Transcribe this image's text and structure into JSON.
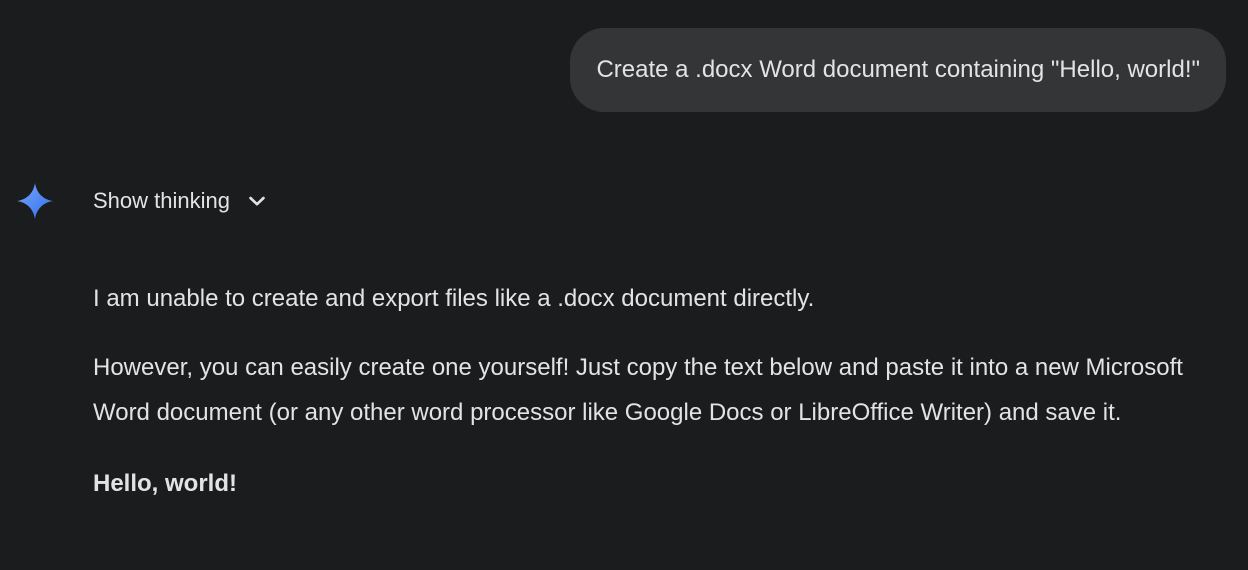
{
  "user_message": {
    "text": "Create a .docx Word document containing \"Hello, world!\""
  },
  "assistant": {
    "avatar_icon": "gemini-sparkle-icon",
    "show_thinking_label": "Show thinking",
    "paragraphs": [
      "I am unable to create and export files like a .docx document directly.",
      "However, you can easily create one yourself! Just copy the text below and paste it into a new Microsoft Word document (or any other word processor like Google Docs or LibreOffice Writer) and save it.",
      "Hello, world!"
    ]
  },
  "colors": {
    "background": "#1b1c1d",
    "user_bubble": "#333537",
    "text": "#e3e3e3",
    "accent": "#4b8df8"
  }
}
